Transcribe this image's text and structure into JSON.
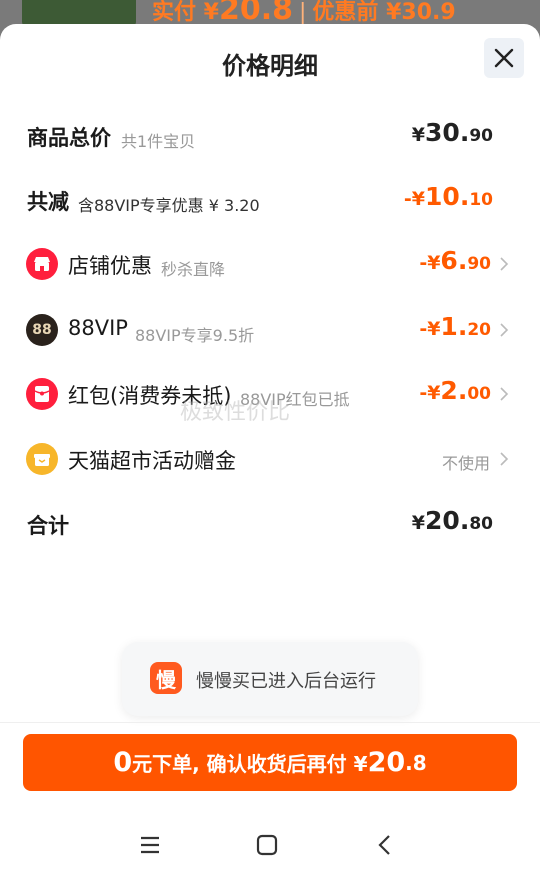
{
  "background_peek": {
    "price_prefix": "实付 ¥",
    "price_value": "20.8",
    "separator": "|",
    "original_label": "优惠前 ¥30.9"
  },
  "sheet": {
    "title": "价格明细"
  },
  "rows": [
    {
      "label": "商品总价",
      "sub": "共1件宝贝",
      "amount_yen": "¥",
      "amount_int": "30.",
      "amount_dec": "90"
    },
    {
      "label": "共减",
      "sub": "含88VIP专享优惠 ¥ 3.20",
      "amount_yen": "-¥",
      "amount_int": "10.",
      "amount_dec": "10"
    },
    {
      "label": "店铺优惠",
      "sub": "秒杀直降",
      "amount_yen": "-¥",
      "amount_int": "6.",
      "amount_dec": "90",
      "icon": "shop-icon",
      "icon_color": "#ff1f3d"
    },
    {
      "label": "88VIP",
      "sub": "88VIP专享9.5折",
      "amount_yen": "-¥",
      "amount_int": "1.",
      "amount_dec": "20",
      "icon": "vip88-icon",
      "icon_color": "#2a221c",
      "icon_text": "88"
    },
    {
      "label": "红包(消费券未抵)",
      "sub": "88VIP红包已抵",
      "amount_yen": "-¥",
      "amount_int": "2.",
      "amount_dec": "00",
      "icon": "red-packet-icon",
      "icon_color": "#ff1f3d"
    },
    {
      "label": "天猫超市活动赠金",
      "unused": "不使用",
      "icon": "gift-box-icon",
      "icon_color": "#f7b62a"
    },
    {
      "label": "合计",
      "amount_yen": "¥",
      "amount_int": "20.",
      "amount_dec": "80"
    }
  ],
  "watermark": "极致性价比",
  "toast": {
    "logo_char": "慢",
    "text": "慢慢买已进入后台运行"
  },
  "cta": {
    "num": "0",
    "text": "元下单, 确认收货后再付 ¥",
    "amount_int": "20",
    "amount_dec": ".8"
  },
  "colors": {
    "accent": "#ff5500",
    "discount": "#ff5a00"
  }
}
